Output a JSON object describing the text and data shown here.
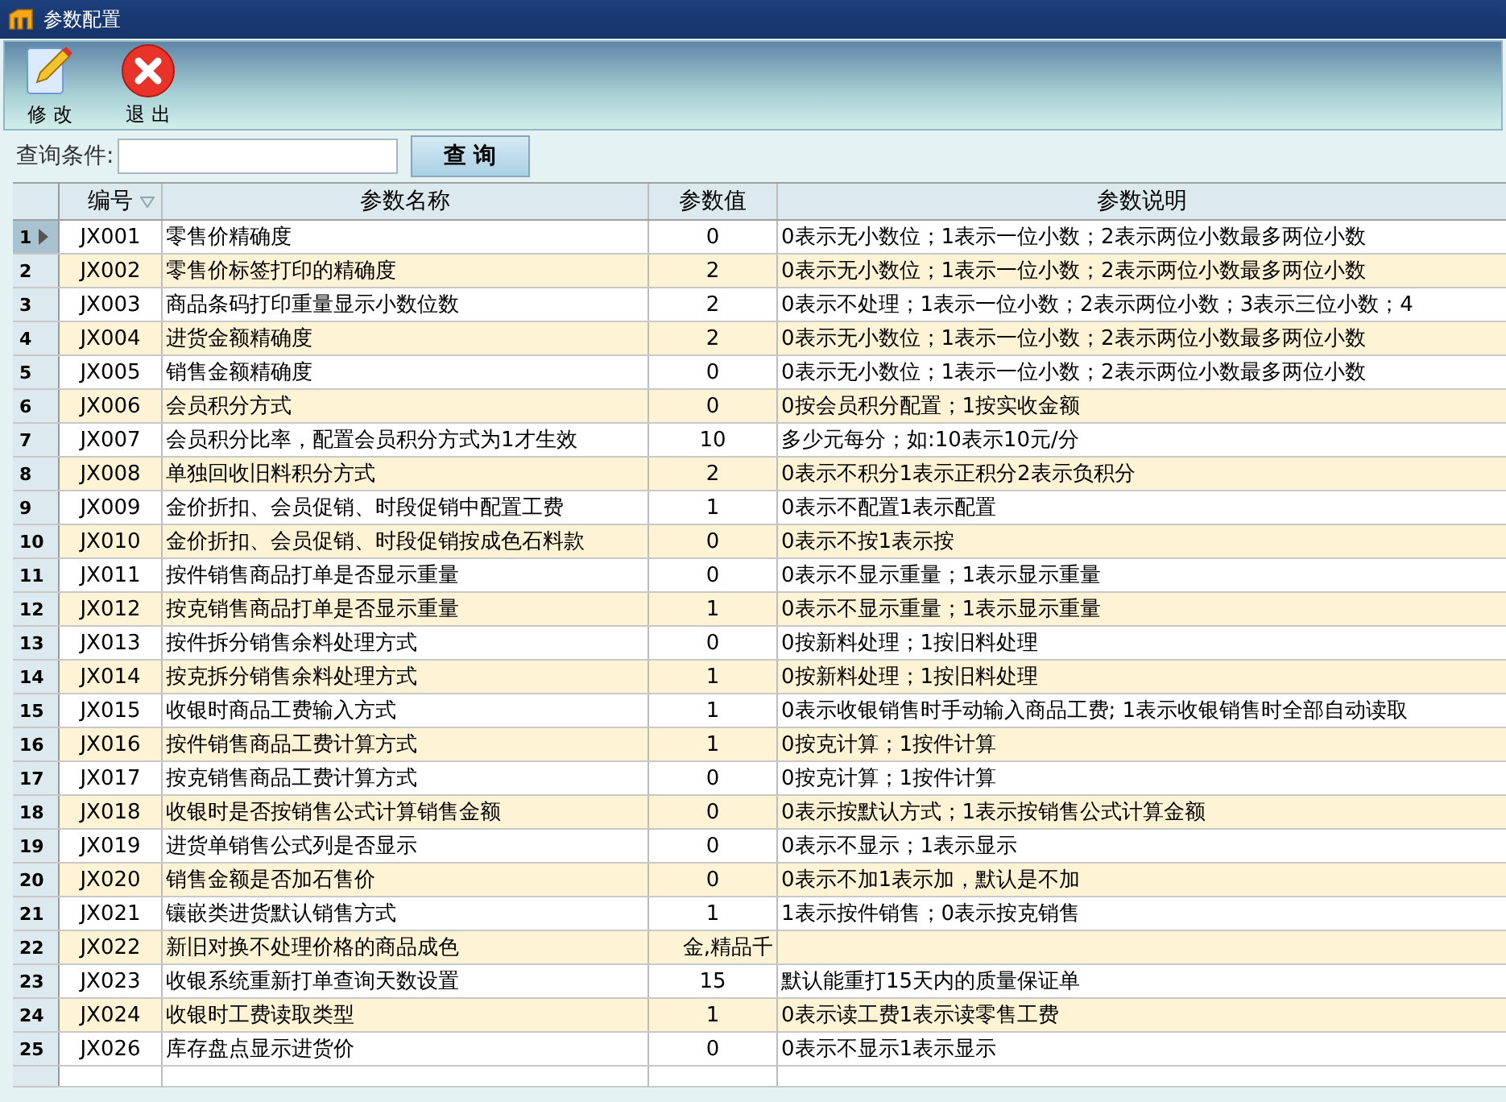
{
  "window": {
    "title": "参数配置"
  },
  "toolbar": [
    {
      "label": "修 改",
      "kind": "edit"
    },
    {
      "label": "退 出",
      "kind": "exit"
    }
  ],
  "query": {
    "label": "查询条件:",
    "button": "查 询"
  },
  "table": {
    "columns": [
      "编号",
      "参数名称",
      "参数值",
      "参数说明"
    ],
    "rows": [
      {
        "num": "1",
        "code": "JX001",
        "name": "零售价精确度",
        "value": "0",
        "desc": "0表示无小数位；1表示一位小数；2表示两位小数最多两位小数",
        "selected": true
      },
      {
        "num": "2",
        "code": "JX002",
        "name": "零售价标签打印的精确度",
        "value": "2",
        "desc": "0表示无小数位；1表示一位小数；2表示两位小数最多两位小数",
        "selected": false
      },
      {
        "num": "3",
        "code": "JX003",
        "name": "商品条码打印重量显示小数位数",
        "value": "2",
        "desc": "0表示不处理；1表示一位小数；2表示两位小数；3表示三位小数；4",
        "selected": false
      },
      {
        "num": "4",
        "code": "JX004",
        "name": "进货金额精确度",
        "value": "2",
        "desc": "0表示无小数位；1表示一位小数；2表示两位小数最多两位小数",
        "selected": false
      },
      {
        "num": "5",
        "code": "JX005",
        "name": "销售金额精确度",
        "value": "0",
        "desc": "0表示无小数位；1表示一位小数；2表示两位小数最多两位小数",
        "selected": false
      },
      {
        "num": "6",
        "code": "JX006",
        "name": "会员积分方式",
        "value": "0",
        "desc": "0按会员积分配置；1按实收金额",
        "selected": false
      },
      {
        "num": "7",
        "code": "JX007",
        "name": "会员积分比率，配置会员积分方式为1才生效",
        "value": "10",
        "desc": "多少元每分；如:10表示10元/分",
        "selected": false
      },
      {
        "num": "8",
        "code": "JX008",
        "name": "单独回收旧料积分方式",
        "value": "2",
        "desc": "0表示不积分1表示正积分2表示负积分",
        "selected": false
      },
      {
        "num": "9",
        "code": "JX009",
        "name": "金价折扣、会员促销、时段促销中配置工费",
        "value": "1",
        "desc": "0表示不配置1表示配置",
        "selected": false
      },
      {
        "num": "10",
        "code": "JX010",
        "name": "金价折扣、会员促销、时段促销按成色石料款",
        "value": "0",
        "desc": "0表示不按1表示按",
        "selected": false
      },
      {
        "num": "11",
        "code": "JX011",
        "name": "按件销售商品打单是否显示重量",
        "value": "0",
        "desc": "0表示不显示重量；1表示显示重量",
        "selected": false
      },
      {
        "num": "12",
        "code": "JX012",
        "name": "按克销售商品打单是否显示重量",
        "value": "1",
        "desc": "0表示不显示重量；1表示显示重量",
        "selected": false
      },
      {
        "num": "13",
        "code": "JX013",
        "name": "按件拆分销售余料处理方式",
        "value": "0",
        "desc": "0按新料处理；1按旧料处理",
        "selected": false
      },
      {
        "num": "14",
        "code": "JX014",
        "name": "按克拆分销售余料处理方式",
        "value": "1",
        "desc": "0按新料处理；1按旧料处理",
        "selected": false
      },
      {
        "num": "15",
        "code": "JX015",
        "name": "收银时商品工费输入方式",
        "value": "1",
        "desc": "0表示收银销售时手动输入商品工费; 1表示收银销售时全部自动读取",
        "selected": false
      },
      {
        "num": "16",
        "code": "JX016",
        "name": "按件销售商品工费计算方式",
        "value": "1",
        "desc": "0按克计算；1按件计算",
        "selected": false
      },
      {
        "num": "17",
        "code": "JX017",
        "name": "按克销售商品工费计算方式",
        "value": "0",
        "desc": "0按克计算；1按件计算",
        "selected": false
      },
      {
        "num": "18",
        "code": "JX018",
        "name": "收银时是否按销售公式计算销售金额",
        "value": "0",
        "desc": "0表示按默认方式；1表示按销售公式计算金额",
        "selected": false
      },
      {
        "num": "19",
        "code": "JX019",
        "name": "进货单销售公式列是否显示",
        "value": "0",
        "desc": "0表示不显示；1表示显示",
        "selected": false
      },
      {
        "num": "20",
        "code": "JX020",
        "name": "销售金额是否加石售价",
        "value": "0",
        "desc": "0表示不加1表示加，默认是不加",
        "selected": false
      },
      {
        "num": "21",
        "code": "JX021",
        "name": "镶嵌类进货默认销售方式",
        "value": "1",
        "desc": "1表示按件销售；0表示按克销售",
        "selected": false
      },
      {
        "num": "22",
        "code": "JX022",
        "name": "新旧对换不处理价格的商品成色",
        "value": "金,精品千",
        "desc": "",
        "selected": false
      },
      {
        "num": "23",
        "code": "JX023",
        "name": "收银系统重新打单查询天数设置",
        "value": "15",
        "desc": "默认能重打15天内的质量保证单",
        "selected": false
      },
      {
        "num": "24",
        "code": "JX024",
        "name": "收银时工费读取类型",
        "value": "1",
        "desc": "0表示读工费1表示读零售工费",
        "selected": false
      },
      {
        "num": "25",
        "code": "JX026",
        "name": "库存盘点显示进货价",
        "value": "0",
        "desc": "0表示不显示1表示显示",
        "selected": false
      }
    ]
  }
}
